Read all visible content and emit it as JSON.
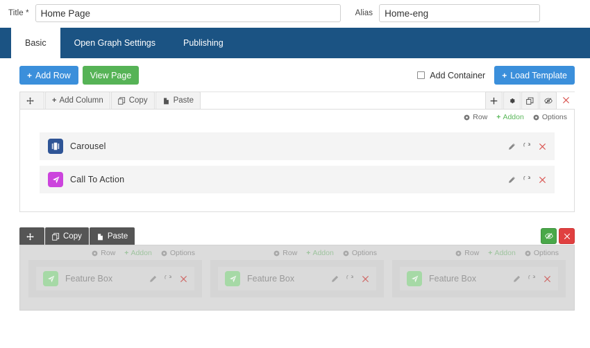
{
  "topbar": {
    "title_label": "Title *",
    "title_value": "Home Page",
    "title_placeholder": "Title",
    "alias_label": "Alias",
    "alias_value": "Home-eng",
    "alias_placeholder": "Alias"
  },
  "tabs": [
    {
      "label": "Basic",
      "active": true
    },
    {
      "label": "Open Graph Settings",
      "active": false
    },
    {
      "label": "Publishing",
      "active": false
    }
  ],
  "toolbar": {
    "add_row_label": "Add Row",
    "view_page_label": "View Page",
    "add_container_label": "Add Container",
    "add_container_checked": false,
    "load_template_label": "Load Template",
    "plus_glyph": "+"
  },
  "row1": {
    "tabs": [
      {
        "label": "",
        "icon": "move-icon"
      },
      {
        "label": "Add Column",
        "icon": "plus-icon"
      },
      {
        "label": "Copy",
        "icon": "copy-icon"
      },
      {
        "label": "Paste",
        "icon": "paste-icon"
      }
    ],
    "icons": [
      "plus-icon",
      "gear-icon",
      "duplicate-icon",
      "eye-slash-icon",
      "close-icon"
    ],
    "meta": [
      {
        "label": "Row",
        "icon": "gear-circle-icon"
      },
      {
        "label": "Addon",
        "icon": "plus-icon"
      },
      {
        "label": "Options",
        "icon": "gear-icon"
      }
    ],
    "addons": [
      {
        "name": "Carousel",
        "icon": "carousel-icon",
        "color": "#2f5596"
      },
      {
        "name": "Call To Action",
        "icon": "paper-plane-icon",
        "color": "#cc44dd"
      }
    ],
    "tools": [
      "pencil-icon",
      "reload-icon",
      "close-icon"
    ]
  },
  "row2": {
    "tabs": [
      {
        "label": "",
        "icon": "move-icon"
      },
      {
        "label": "Copy",
        "icon": "copy-icon"
      },
      {
        "label": "Paste",
        "icon": "paste-icon"
      }
    ],
    "buttons": [
      {
        "icon": "eye-slash-icon",
        "color": "#49a849"
      },
      {
        "icon": "close-icon",
        "color": "#e04040"
      }
    ],
    "meta": [
      {
        "label": "Row",
        "icon": "gear-circle-icon"
      },
      {
        "label": "Addon",
        "icon": "plus-icon"
      },
      {
        "label": "Options",
        "icon": "gear-icon"
      }
    ],
    "columns": [
      {
        "addon": {
          "name": "Feature Box",
          "icon": "paper-plane-icon",
          "color": "#a6d9a6"
        }
      },
      {
        "addon": {
          "name": "Feature Box",
          "icon": "paper-plane-icon",
          "color": "#a6d9a6"
        }
      },
      {
        "addon": {
          "name": "Feature Box",
          "icon": "paper-plane-icon",
          "color": "#a6d9a6"
        }
      }
    ],
    "tools": [
      "pencil-icon",
      "reload-icon",
      "close-icon"
    ]
  },
  "colors": {
    "navbar": "#1b5383",
    "primary": "#3b8fdb",
    "success": "#56b356",
    "danger": "#d9534f",
    "addon_green": "#5cb85c"
  }
}
